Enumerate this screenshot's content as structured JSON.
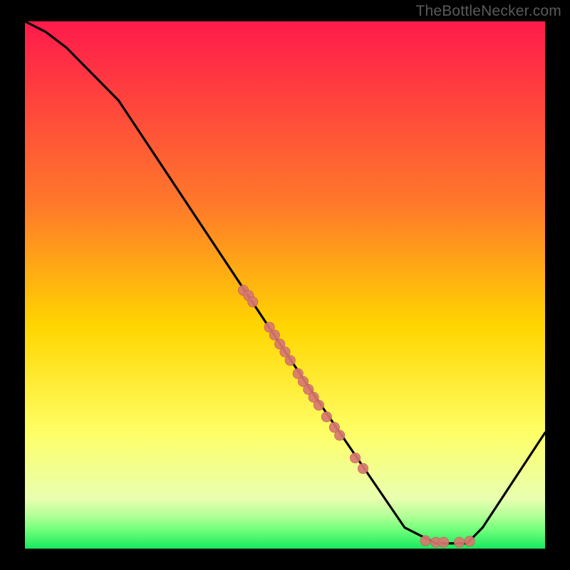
{
  "watermark": "TheBottleNecker.com",
  "colors": {
    "black": "#000000",
    "line": "#000000",
    "point_fill": "#d87770",
    "point_stroke": "#c05a52",
    "grad_top": "#ff1a4b",
    "grad_mid_top": "#ff7a2a",
    "grad_mid": "#ffd600",
    "grad_low": "#ffff66",
    "grad_band1": "#e8ffb0",
    "grad_band2": "#b8ff9a",
    "grad_band3": "#6fff7a",
    "grad_bottom": "#17e85e"
  },
  "chart_data": {
    "type": "line",
    "title": "",
    "xlabel": "",
    "ylabel": "",
    "xlim": [
      0,
      100
    ],
    "ylim": [
      0,
      100
    ],
    "series": [
      {
        "name": "curve",
        "x": [
          0,
          4,
          8,
          12,
          18,
          55,
          73,
          79,
          85,
          88,
          100
        ],
        "y": [
          100,
          98,
          95,
          91,
          85,
          30,
          4,
          1,
          1,
          4,
          22
        ]
      }
    ],
    "points": [
      {
        "x": 42.0,
        "y": 49.0
      },
      {
        "x": 43.0,
        "y": 48.0
      },
      {
        "x": 43.8,
        "y": 46.8
      },
      {
        "x": 47.0,
        "y": 42.0
      },
      {
        "x": 48.0,
        "y": 40.5
      },
      {
        "x": 49.0,
        "y": 38.8
      },
      {
        "x": 50.0,
        "y": 37.3
      },
      {
        "x": 51.0,
        "y": 35.7
      },
      {
        "x": 52.5,
        "y": 33.2
      },
      {
        "x": 53.5,
        "y": 31.7
      },
      {
        "x": 54.5,
        "y": 30.2
      },
      {
        "x": 55.5,
        "y": 28.7
      },
      {
        "x": 56.5,
        "y": 27.2
      },
      {
        "x": 58.0,
        "y": 25.0
      },
      {
        "x": 59.5,
        "y": 23.0
      },
      {
        "x": 60.5,
        "y": 21.5
      },
      {
        "x": 63.5,
        "y": 17.2
      },
      {
        "x": 65.0,
        "y": 15.2
      },
      {
        "x": 77.0,
        "y": 1.5
      },
      {
        "x": 79.0,
        "y": 1.2
      },
      {
        "x": 80.5,
        "y": 1.2
      },
      {
        "x": 83.5,
        "y": 1.2
      },
      {
        "x": 85.5,
        "y": 1.4
      }
    ],
    "point_radius": 7.2
  }
}
